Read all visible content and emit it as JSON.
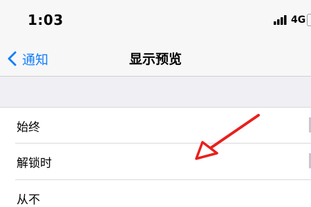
{
  "status_bar": {
    "time": "1:03",
    "network": "4G",
    "icons": [
      "signal-bars-icon",
      "battery-icon"
    ]
  },
  "nav": {
    "back_label": "通知",
    "title": "显示预览",
    "back_icon": "chevron-left-icon"
  },
  "options": [
    {
      "label": "始终"
    },
    {
      "label": "解锁时"
    },
    {
      "label": "从不"
    }
  ],
  "colors": {
    "accent": "#147efb",
    "annotation_arrow": "#e8201c",
    "background": "#efeff4"
  }
}
